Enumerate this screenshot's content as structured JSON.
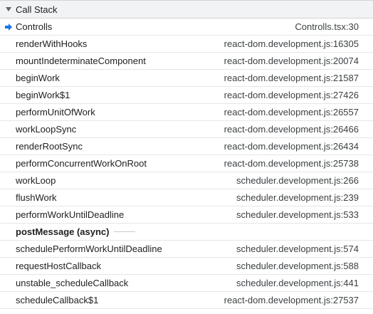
{
  "header": {
    "title": "Call Stack"
  },
  "frames": [
    {
      "fn": "Controlls",
      "loc": "Controlls.tsx:30",
      "current": true
    },
    {
      "fn": "renderWithHooks",
      "loc": "react-dom.development.js:16305"
    },
    {
      "fn": "mountIndeterminateComponent",
      "loc": "react-dom.development.js:20074"
    },
    {
      "fn": "beginWork",
      "loc": "react-dom.development.js:21587"
    },
    {
      "fn": "beginWork$1",
      "loc": "react-dom.development.js:27426"
    },
    {
      "fn": "performUnitOfWork",
      "loc": "react-dom.development.js:26557"
    },
    {
      "fn": "workLoopSync",
      "loc": "react-dom.development.js:26466"
    },
    {
      "fn": "renderRootSync",
      "loc": "react-dom.development.js:26434"
    },
    {
      "fn": "performConcurrentWorkOnRoot",
      "loc": "react-dom.development.js:25738"
    },
    {
      "fn": "workLoop",
      "loc": "scheduler.development.js:266"
    },
    {
      "fn": "flushWork",
      "loc": "scheduler.development.js:239"
    },
    {
      "fn": "performWorkUntilDeadline",
      "loc": "scheduler.development.js:533"
    }
  ],
  "async_marker": "postMessage (async)",
  "async_frames": [
    {
      "fn": "schedulePerformWorkUntilDeadline",
      "loc": "scheduler.development.js:574"
    },
    {
      "fn": "requestHostCallback",
      "loc": "scheduler.development.js:588"
    },
    {
      "fn": "unstable_scheduleCallback",
      "loc": "scheduler.development.js:441"
    },
    {
      "fn": "scheduleCallback$1",
      "loc": "react-dom.development.js:27537"
    }
  ],
  "colors": {
    "current_arrow": "#1a73e8"
  },
  "icons": {
    "section_toggle": "triangle-down-icon",
    "current_frame": "current-frame-arrow-icon"
  }
}
